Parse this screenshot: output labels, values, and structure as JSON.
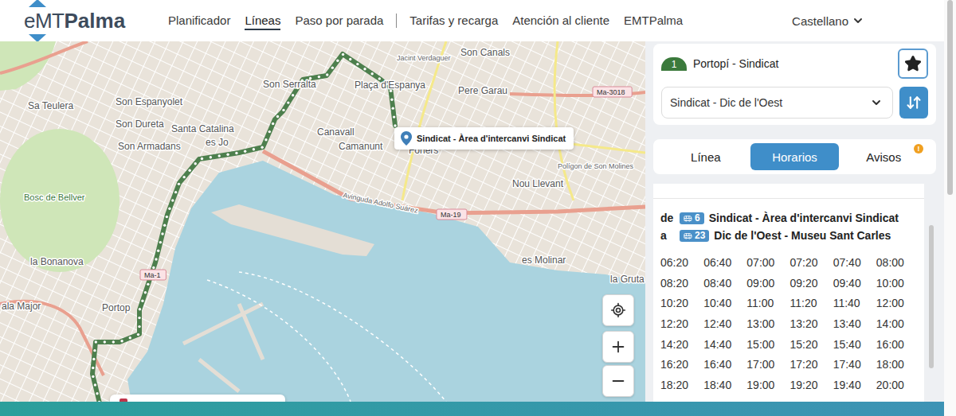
{
  "header": {
    "logo": {
      "prefix": "eMT",
      "name": "Palma"
    },
    "nav_groups": [
      [
        {
          "label": "Planificador",
          "selected": false
        },
        {
          "label": "Líneas",
          "selected": true
        },
        {
          "label": "Paso por parada",
          "selected": false
        }
      ],
      [
        {
          "label": "Tarifas y recarga",
          "selected": false
        },
        {
          "label": "Atención al cliente",
          "selected": false
        },
        {
          "label": "EMTPalma",
          "selected": false
        }
      ]
    ],
    "language": "Castellano"
  },
  "map": {
    "labels": [
      {
        "text": "Son Serralta",
        "kind": "place"
      },
      {
        "text": "Son Espanyolet",
        "kind": "place"
      },
      {
        "text": "Sa Teulera",
        "kind": "place"
      },
      {
        "text": "Son Dureta",
        "kind": "place"
      },
      {
        "text": "Santa Catalina",
        "kind": "place"
      },
      {
        "text": "Son Armadans",
        "kind": "place"
      },
      {
        "text": "es Jo",
        "kind": "place"
      },
      {
        "text": "Canavall",
        "kind": "place"
      },
      {
        "text": "Camanunt",
        "kind": "place"
      },
      {
        "text": "Plaça d'Espanya",
        "kind": "place"
      },
      {
        "text": "Jacint Verdaguer",
        "kind": "street"
      },
      {
        "text": "Son Canals",
        "kind": "place"
      },
      {
        "text": "Pere Garau",
        "kind": "place"
      },
      {
        "text": "Foners",
        "kind": "place"
      },
      {
        "text": "Nou Llevant",
        "kind": "place"
      },
      {
        "text": "Polígon de Son Molines",
        "kind": "street"
      },
      {
        "text": "es Molinar",
        "kind": "place"
      },
      {
        "text": "la Gruta",
        "kind": "place"
      },
      {
        "text": "Bosc de Bellver",
        "kind": "park"
      },
      {
        "text": "la Bonanova",
        "kind": "place"
      },
      {
        "text": "ala Major",
        "kind": "place"
      },
      {
        "text": "Portop",
        "kind": "place"
      },
      {
        "text": "Avinguda Adolfo Suárez",
        "kind": "street"
      },
      {
        "text": "Ma-19",
        "kind": "shield"
      },
      {
        "text": "Ma-3018",
        "kind": "shield"
      },
      {
        "text": "Ma-1",
        "kind": "shield"
      }
    ],
    "stop_tooltip": "Sindicat - Àrea d'intercanvi Sindicat"
  },
  "panel": {
    "line": {
      "number": "1",
      "name": "Portopí - Sindicat"
    },
    "direction": "Sindicat - Dic de l'Oest",
    "tabs": [
      {
        "label": "Línea",
        "selected": false,
        "badge": ""
      },
      {
        "label": "Horarios",
        "selected": true,
        "badge": ""
      },
      {
        "label": "Avisos",
        "selected": false,
        "badge": "!"
      }
    ],
    "schedule": {
      "from": {
        "prefix": "de",
        "stop_number": "6",
        "stop_name": "Sindicat - Àrea d'intercanvi Sindicat"
      },
      "to": {
        "prefix": "a",
        "stop_number": "23",
        "stop_name": "Dic de l'Oest - Museu Sant Carles"
      },
      "times": [
        "06:20",
        "06:40",
        "07:00",
        "07:20",
        "07:40",
        "08:00",
        "08:20",
        "08:40",
        "09:00",
        "09:20",
        "09:40",
        "10:00",
        "10:20",
        "10:40",
        "11:00",
        "11:20",
        "11:40",
        "12:00",
        "12:20",
        "12:40",
        "13:00",
        "13:20",
        "13:40",
        "14:00",
        "14:20",
        "14:40",
        "15:00",
        "15:20",
        "15:40",
        "16:00",
        "16:20",
        "16:40",
        "17:00",
        "17:20",
        "17:40",
        "18:00",
        "18:20",
        "18:40",
        "19:00",
        "19:20",
        "19:40",
        "20:00"
      ]
    }
  }
}
